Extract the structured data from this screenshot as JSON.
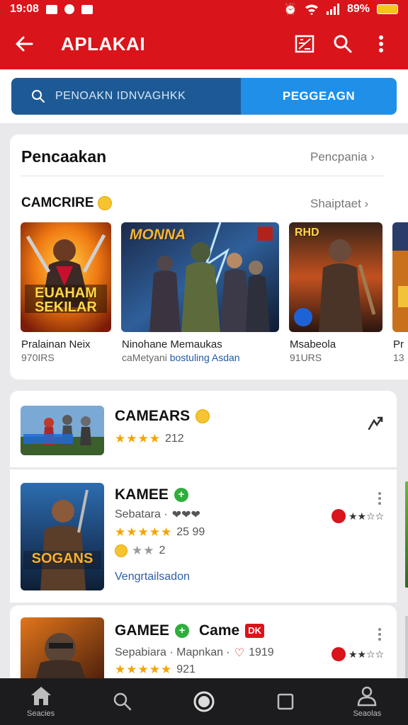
{
  "status_bar": {
    "time": "19:08",
    "battery": "89%"
  },
  "app_bar": {
    "title": "APLAKAI"
  },
  "search": {
    "placeholder": "PENOAKN IDNVAGHKK",
    "button_label": "PEGGEAGN"
  },
  "recommended": {
    "title": "Pencaakan",
    "more": "Pencpania ›",
    "category_title": "CAMCRIRE",
    "category_more": "Shaiptaet ›",
    "items": [
      {
        "name": "Pralainan Neix",
        "sub": "970IRS",
        "art_title": "EUAHAM SEKILAR"
      },
      {
        "name": "Ninohane Memaukas",
        "sub": "caMetyani",
        "sub_link": "bostuling Asdan",
        "art_title": "MONNA"
      },
      {
        "name": "Msabeola",
        "sub": "91URS",
        "art_title": "RHD"
      },
      {
        "name": "Pr",
        "sub": "13"
      }
    ]
  },
  "list": [
    {
      "title": "CAMEARS",
      "rating_text": "212"
    },
    {
      "title": "KAMEE",
      "meta": "Sebatara ·",
      "meta_extra": "❤❤❤",
      "rating_count": "25 99",
      "secondary_count": "2",
      "link": "Vengrtailsadon",
      "art_title": "SOGANS"
    },
    {
      "title": "GAMEE",
      "title_extra": "Came",
      "badge": "DK",
      "meta": "Sepabiara · Mapnkan ·",
      "meta_extra": "1919",
      "rating_count": "921"
    }
  ],
  "bottom_nav": {
    "home_label": "Seacies",
    "profile_label": "Seaolas"
  },
  "colors": {
    "brand_red": "#d9141a",
    "search_blue": "#1f8fe8",
    "search_dark": "#1d5a95",
    "star": "#f4a400"
  }
}
